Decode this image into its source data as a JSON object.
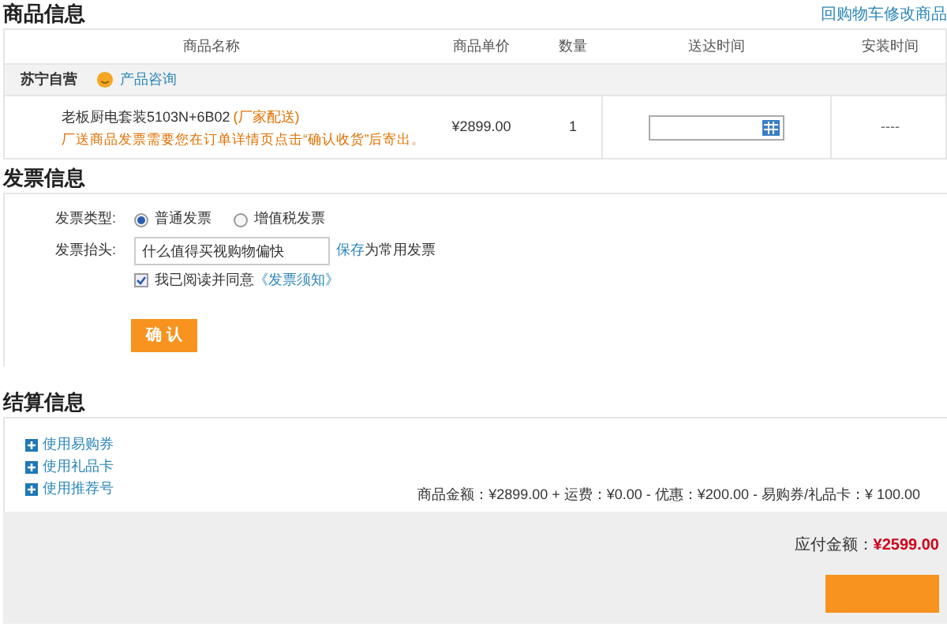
{
  "goods": {
    "title": "商品信息",
    "back_link": "回购物车修改商品",
    "columns": [
      "商品名称",
      "商品单价",
      "数量",
      "送达时间",
      "安装时间"
    ],
    "store": {
      "name": "苏宁自营",
      "consult": "产品咨询"
    },
    "item": {
      "name": "老板厨电套装5103N+6B02",
      "tag": "(厂家配送)",
      "note": "厂送商品发票需要您在订单详情页点击“确认收货”后寄出。",
      "price": "¥2899.00",
      "qty": "1",
      "install": "----"
    }
  },
  "invoice": {
    "title": "发票信息",
    "type_label": "发票类型:",
    "types": [
      {
        "label": "普通发票",
        "selected": true
      },
      {
        "label": "增值税发票",
        "selected": false
      }
    ],
    "header_label": "发票抬头:",
    "header_value": "什么值得买视购物偏快",
    "save_link": "保存",
    "save_text": "为常用发票",
    "agree": {
      "checked": true,
      "text": "我已阅读并同意",
      "link": "《发票须知》"
    },
    "confirm": "确 认"
  },
  "settlement": {
    "title": "结算信息",
    "options": [
      "使用易购券",
      "使用礼品卡",
      "使用推荐号"
    ],
    "summary": "商品金额：¥2899.00 + 运费：¥0.00 - 优惠：¥200.00 - 易购券/礼品卡：¥ 100.00",
    "due_label": "应付金额：",
    "due_amount": "¥2599.00"
  }
}
